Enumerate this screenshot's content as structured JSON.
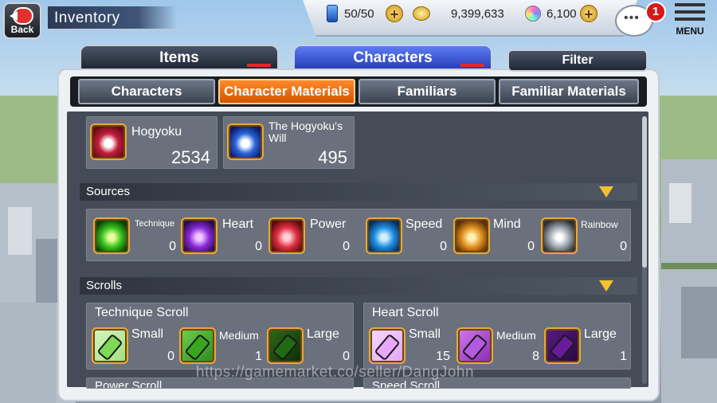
{
  "header": {
    "back_label": "Back",
    "title": "Inventory",
    "stamina": "50/50",
    "coins": "9,399,633",
    "orbs": "6,100",
    "notification_count": "1",
    "menu_label": "MENU"
  },
  "main_tabs": [
    {
      "label": "Items",
      "active": false
    },
    {
      "label": "Characters",
      "active": true
    }
  ],
  "filter_label": "Filter",
  "sub_tabs": [
    {
      "label": "Characters",
      "active": false
    },
    {
      "label": "Character Materials",
      "active": true
    },
    {
      "label": "Familiars",
      "active": false
    },
    {
      "label": "Familiar Materials",
      "active": false
    }
  ],
  "top_items": [
    {
      "name": "Hogyoku",
      "count": "2534",
      "icon": "hogyoku-icon"
    },
    {
      "name": "The Hogyoku's\nWill",
      "count": "495",
      "icon": "hogyoku-will-icon"
    }
  ],
  "sources": {
    "title": "Sources",
    "items": [
      {
        "name": "Technique",
        "count": "0",
        "icon": "technique-source-icon"
      },
      {
        "name": "Heart",
        "count": "0",
        "icon": "heart-source-icon"
      },
      {
        "name": "Power",
        "count": "0",
        "icon": "power-source-icon"
      },
      {
        "name": "Speed",
        "count": "0",
        "icon": "speed-source-icon"
      },
      {
        "name": "Mind",
        "count": "0",
        "icon": "mind-source-icon"
      },
      {
        "name": "Rainbow",
        "count": "0",
        "icon": "rainbow-source-icon"
      }
    ]
  },
  "scrolls": {
    "title": "Scrolls",
    "groups": [
      {
        "name": "Technique Scroll",
        "items": [
          {
            "size": "Small",
            "count": "0"
          },
          {
            "size": "Medium",
            "count": "1"
          },
          {
            "size": "Large",
            "count": "0"
          }
        ]
      },
      {
        "name": "Heart Scroll",
        "items": [
          {
            "size": "Small",
            "count": "15"
          },
          {
            "size": "Medium",
            "count": "8"
          },
          {
            "size": "Large",
            "count": "1"
          }
        ]
      },
      {
        "name": "Power Scroll"
      },
      {
        "name": "Speed Scroll"
      }
    ]
  },
  "watermark": "https://gamemarket.co/seller/DangJohn",
  "colors": {
    "active_tab": "#ff8a2a",
    "active_main_tab": "#3f55d9",
    "content_bg": "#454c57",
    "section_arrow": "#f2c12e"
  }
}
